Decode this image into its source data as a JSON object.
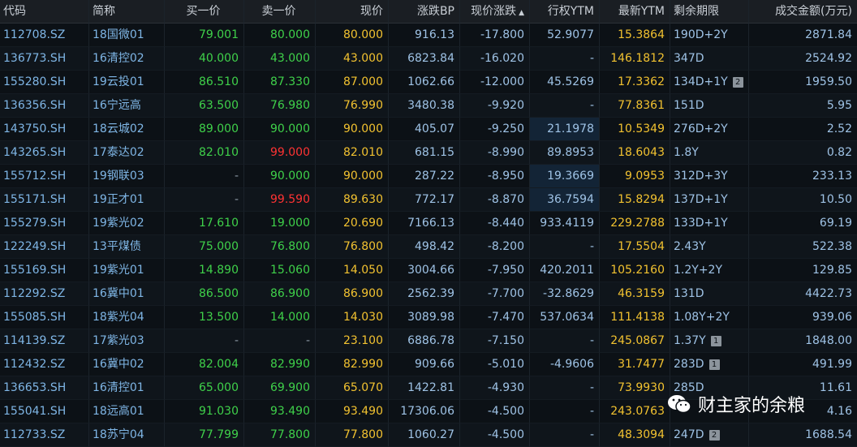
{
  "columns": [
    "代码",
    "简称",
    "买一价",
    "卖一价",
    "现价",
    "涨跌BP",
    "现价涨跌",
    "行权YTM",
    "最新YTM",
    "剩余期限",
    "成交金额(万元)"
  ],
  "rows": [
    {
      "code": "112708.SZ",
      "name": "18国微01",
      "bid": "79.001",
      "ask": "80.000",
      "ask_red": false,
      "price": "80.000",
      "bp": "916.13",
      "chg": "-17.800",
      "ytm_ex": "52.9077",
      "ytm": "15.3864",
      "term": "190D+2Y",
      "badge": "",
      "amt": "2871.84"
    },
    {
      "code": "136773.SH",
      "name": "16清控02",
      "bid": "40.000",
      "ask": "43.000",
      "ask_red": false,
      "price": "43.000",
      "bp": "6823.84",
      "chg": "-16.020",
      "ytm_ex": "-",
      "ytm": "146.1812",
      "term": "347D",
      "badge": "",
      "amt": "2524.92"
    },
    {
      "code": "155280.SH",
      "name": "19云投01",
      "bid": "86.510",
      "ask": "87.330",
      "ask_red": false,
      "price": "87.000",
      "bp": "1062.66",
      "chg": "-12.000",
      "ytm_ex": "45.5269",
      "ytm": "17.3362",
      "term": "134D+1Y",
      "badge": "2",
      "amt": "1959.50"
    },
    {
      "code": "136356.SH",
      "name": "16宁远高",
      "bid": "63.500",
      "ask": "76.980",
      "ask_red": false,
      "price": "76.990",
      "bp": "3480.38",
      "chg": "-9.920",
      "ytm_ex": "-",
      "ytm": "77.8361",
      "term": "151D",
      "badge": "",
      "amt": "5.95"
    },
    {
      "code": "143750.SH",
      "name": "18云城02",
      "bid": "89.000",
      "ask": "90.000",
      "ask_red": false,
      "price": "90.000",
      "bp": "405.07",
      "chg": "-9.250",
      "ytm_ex": "21.1978",
      "ytm": "10.5349",
      "term": "276D+2Y",
      "badge": "",
      "amt": "2.52"
    },
    {
      "code": "143265.SH",
      "name": "17泰达02",
      "bid": "82.010",
      "ask": "99.000",
      "ask_red": true,
      "price": "82.010",
      "bp": "681.15",
      "chg": "-8.990",
      "ytm_ex": "89.8953",
      "ytm": "18.6043",
      "term": "1.8Y",
      "badge": "",
      "amt": "0.82"
    },
    {
      "code": "155712.SH",
      "name": "19钢联03",
      "bid": "-",
      "ask": "90.000",
      "ask_red": false,
      "price": "90.000",
      "bp": "287.22",
      "chg": "-8.950",
      "ytm_ex": "19.3669",
      "ytm": "9.0953",
      "term": "312D+3Y",
      "badge": "",
      "amt": "233.13"
    },
    {
      "code": "155171.SH",
      "name": "19正才01",
      "bid": "-",
      "ask": "99.590",
      "ask_red": true,
      "price": "89.630",
      "bp": "772.17",
      "chg": "-8.870",
      "ytm_ex": "36.7594",
      "ytm": "15.8294",
      "term": "137D+1Y",
      "badge": "",
      "amt": "10.50"
    },
    {
      "code": "155279.SH",
      "name": "19紫光02",
      "bid": "17.610",
      "ask": "19.000",
      "ask_red": false,
      "price": "20.690",
      "bp": "7166.13",
      "chg": "-8.440",
      "ytm_ex": "933.4119",
      "ytm": "229.2788",
      "term": "133D+1Y",
      "badge": "",
      "amt": "69.19"
    },
    {
      "code": "122249.SH",
      "name": "13平煤债",
      "bid": "75.000",
      "ask": "76.800",
      "ask_red": false,
      "price": "76.800",
      "bp": "498.42",
      "chg": "-8.200",
      "ytm_ex": "-",
      "ytm": "17.5504",
      "term": "2.43Y",
      "badge": "",
      "amt": "522.38"
    },
    {
      "code": "155169.SH",
      "name": "19紫光01",
      "bid": "14.890",
      "ask": "15.060",
      "ask_red": false,
      "price": "14.050",
      "bp": "3004.66",
      "chg": "-7.950",
      "ytm_ex": "420.2011",
      "ytm": "105.2160",
      "term": "1.2Y+2Y",
      "badge": "",
      "amt": "129.85"
    },
    {
      "code": "112292.SZ",
      "name": "16冀中01",
      "bid": "86.500",
      "ask": "86.900",
      "ask_red": false,
      "price": "86.900",
      "bp": "2562.39",
      "chg": "-7.700",
      "ytm_ex": "-32.8629",
      "ytm": "46.3159",
      "term": "131D",
      "badge": "",
      "amt": "4422.73"
    },
    {
      "code": "155085.SH",
      "name": "18紫光04",
      "bid": "13.500",
      "ask": "14.000",
      "ask_red": false,
      "price": "14.030",
      "bp": "3089.98",
      "chg": "-7.470",
      "ytm_ex": "537.0634",
      "ytm": "111.4138",
      "term": "1.08Y+2Y",
      "badge": "",
      "amt": "939.06"
    },
    {
      "code": "114139.SZ",
      "name": "17紫光03",
      "bid": "-",
      "ask": "-",
      "ask_red": false,
      "price": "23.100",
      "bp": "6886.78",
      "chg": "-7.150",
      "ytm_ex": "-",
      "ytm": "245.0867",
      "term": "1.37Y",
      "badge": "1",
      "amt": "1848.00"
    },
    {
      "code": "112432.SZ",
      "name": "16冀中02",
      "bid": "82.004",
      "ask": "82.990",
      "ask_red": false,
      "price": "82.990",
      "bp": "909.66",
      "chg": "-5.010",
      "ytm_ex": "-4.9606",
      "ytm": "31.7477",
      "term": "283D",
      "badge": "1",
      "amt": "491.99"
    },
    {
      "code": "136653.SH",
      "name": "16清控01",
      "bid": "65.000",
      "ask": "69.900",
      "ask_red": false,
      "price": "65.070",
      "bp": "1422.81",
      "chg": "-4.930",
      "ytm_ex": "-",
      "ytm": "73.9930",
      "term": "285D",
      "badge": "",
      "amt": "11.61"
    },
    {
      "code": "155041.SH",
      "name": "18远高01",
      "bid": "91.030",
      "ask": "93.490",
      "ask_red": false,
      "price": "93.490",
      "bp": "17306.06",
      "chg": "-4.500",
      "ytm_ex": "-",
      "ytm": "243.0763",
      "term": "",
      "badge": "",
      "amt": "4.16"
    },
    {
      "code": "112733.SZ",
      "name": "18苏宁04",
      "bid": "77.799",
      "ask": "77.800",
      "ask_red": false,
      "price": "77.800",
      "bp": "1060.27",
      "chg": "-4.500",
      "ytm_ex": "-",
      "ytm": "48.3094",
      "term": "247D",
      "badge": "2",
      "amt": "1688.54"
    }
  ],
  "watermark": {
    "icon": "wechat-icon",
    "text": "财主家的余粮"
  },
  "colors": {
    "bid": "#3fd14a",
    "ask": "#3fd14a",
    "ask_alert": "#ff3333",
    "price": "#f2c230",
    "code": "#7fb6e6"
  }
}
